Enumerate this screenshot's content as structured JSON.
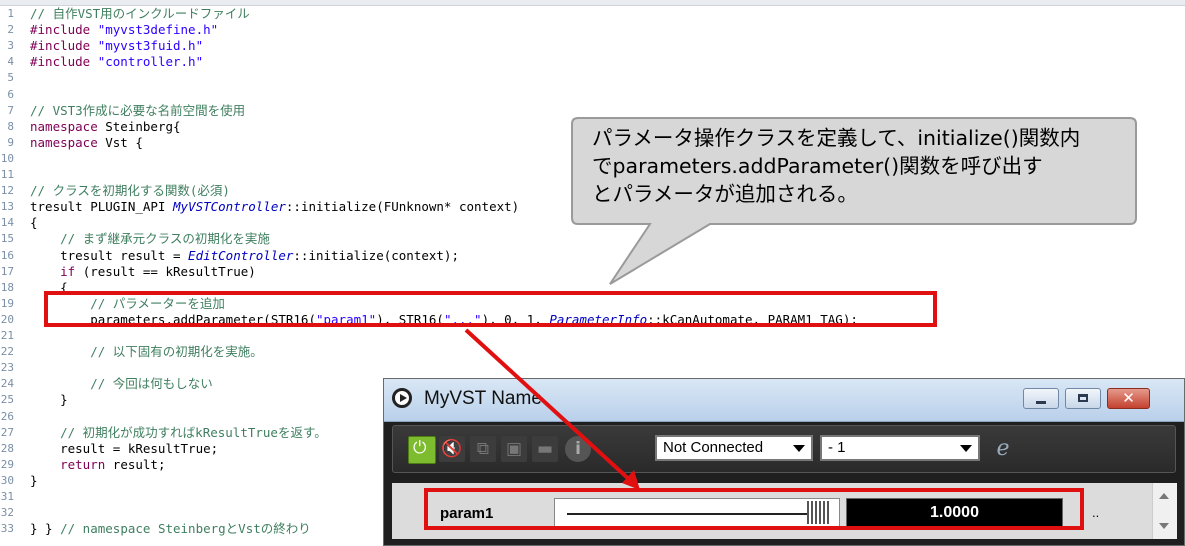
{
  "editor": {
    "line_numbers": [
      "1",
      "2",
      "3",
      "4",
      "5",
      "6",
      "7",
      "8",
      "9",
      "10",
      "11",
      "12",
      "13",
      "14",
      "15",
      "16",
      "17",
      "18",
      "19",
      "20",
      "21",
      "22",
      "23",
      "24",
      "25",
      "26",
      "27",
      "28",
      "29",
      "30",
      "31",
      "32",
      "33"
    ],
    "lines": {
      "l1": "// 自作VST用のインクルードファイル",
      "l2a": "#include ",
      "l2b": "\"myvst3define.h\"",
      "l3a": "#include ",
      "l3b": "\"myvst3fuid.h\"",
      "l4a": "#include ",
      "l4b": "\"controller.h\"",
      "l7": "// VST3作成に必要な名前空間を使用",
      "l8a": "namespace",
      "l8b": " Steinberg{",
      "l9a": "namespace",
      "l9b": " Vst {",
      "l12": "// クラスを初期化する関数(必須)",
      "l13a": "tresult PLUGIN_API ",
      "l13b": "MyVSTController",
      "l13c": "::initialize(FUnknown* context)",
      "l14": "{",
      "l15": "    // まず継承元クラスの初期化を実施",
      "l16a": "    tresult result = ",
      "l16b": "EditController",
      "l16c": "::initialize(context);",
      "l17a": "    ",
      "l17b": "if",
      "l17c": " (result == kResultTrue)",
      "l18": "    {",
      "l19": "        // パラメーターを追加",
      "l20a": "        parameters.addParameter(STR16(",
      "l20b": "\"param1\"",
      "l20c": "), STR16(",
      "l20d": "\"...\"",
      "l20e": "), 0, 1, ",
      "l20f": "ParameterInfo",
      "l20g": "::kCanAutomate, PARAM1_TAG);",
      "l22": "        // 以下固有の初期化を実施。",
      "l24": "        // 今回は何もしない",
      "l25": "    }",
      "l27": "    // 初期化が成功すればkResultTrueを返す。",
      "l28": "    result = kResultTrue;",
      "l29a": "    ",
      "l29b": "return",
      "l29c": " result;",
      "l30": "}",
      "l33a": "} } ",
      "l33b": "// namespace SteinbergとVstの終わり"
    }
  },
  "callout": {
    "text_line1": "パラメータ操作クラスを定義して、initialize()関数内",
    "text_line2": "でparameters.addParameter()関数を呼び出す",
    "text_line3": "とパラメータが追加される。"
  },
  "plugin_window": {
    "title": "MyVST Name",
    "close_label": "✕",
    "connection_select": "Not Connected",
    "program_select": "- 1",
    "edit_label": "e",
    "info_label": "i",
    "param": {
      "name": "param1",
      "value_display": "1.0000",
      "value_fraction": 1.0,
      "unit": ".."
    }
  },
  "colors": {
    "highlight": "#e01010",
    "power_on": "#7cbc2e",
    "comment": "#3f7f5f",
    "keyword": "#7f0055",
    "string": "#2a00ff"
  },
  "icons": [
    "power-icon",
    "mute-icon",
    "bypass-icon",
    "save-icon",
    "open-folder-icon",
    "info-icon",
    "edit-icon",
    "app-icon"
  ]
}
